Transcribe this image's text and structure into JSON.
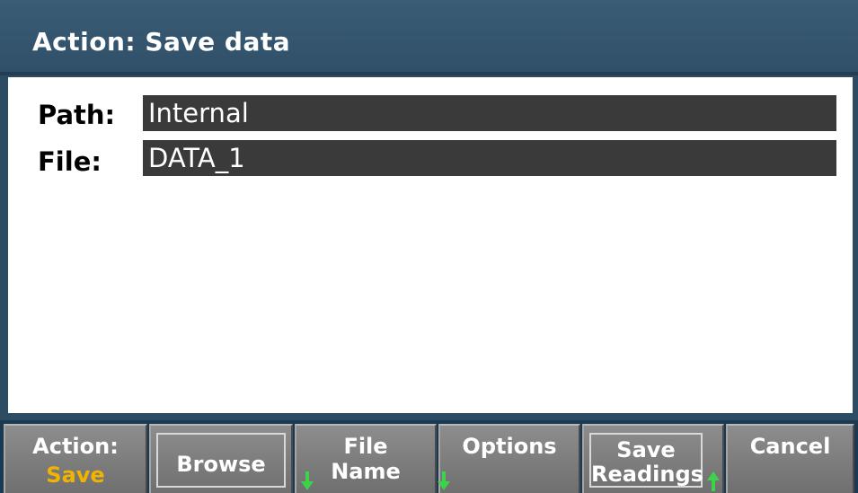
{
  "header": {
    "title": "Action: Save data"
  },
  "form": {
    "path_label": "Path:",
    "path_value": "Internal",
    "file_label": "File:",
    "file_value": "DATA_1"
  },
  "softkeys": {
    "action": {
      "line1": "Action:",
      "line2": "Save"
    },
    "browse": {
      "label": "Browse"
    },
    "file_name": {
      "line1": "File",
      "line2": "Name",
      "arrow": "down-arrow-icon"
    },
    "options": {
      "label": "Options",
      "arrow": "down-arrow-icon"
    },
    "save_readings": {
      "line1": "Save",
      "line2": "Readings",
      "arrow": "up-arrow-icon"
    },
    "cancel": {
      "label": "Cancel"
    }
  },
  "colors": {
    "title_bar": "#2f5068",
    "accent": "#f0b400",
    "arrow": "#3cd24a"
  }
}
